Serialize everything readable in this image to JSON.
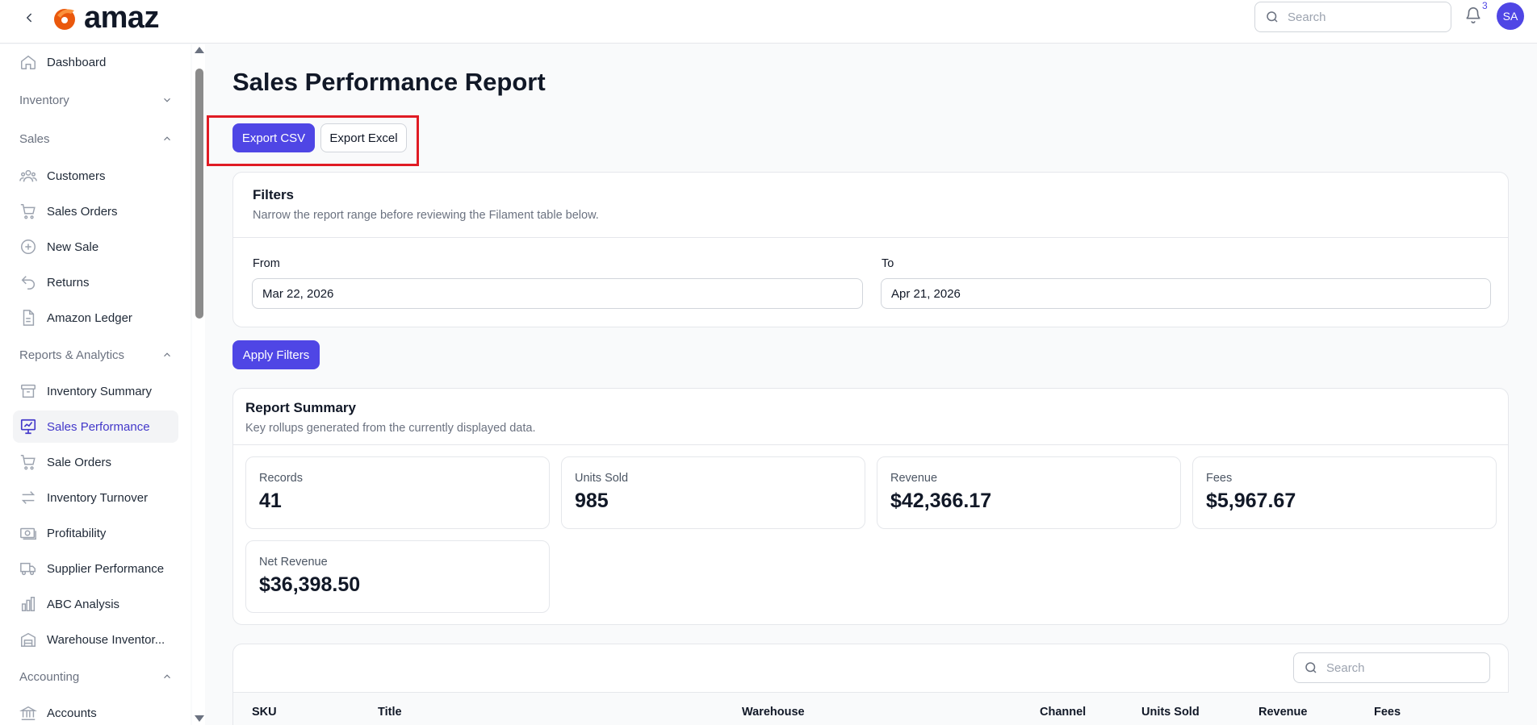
{
  "header": {
    "logo_text": "amaz",
    "search_placeholder": "Search",
    "notification_count": "3",
    "avatar_initials": "SA"
  },
  "sidebar": {
    "dashboard": "Dashboard",
    "inventory_group": "Inventory",
    "sales_group": "Sales",
    "customers": "Customers",
    "sales_orders": "Sales Orders",
    "new_sale": "New Sale",
    "returns": "Returns",
    "amazon_ledger": "Amazon Ledger",
    "reports_group": "Reports & Analytics",
    "inventory_summary": "Inventory Summary",
    "sales_performance": "Sales Performance",
    "sale_orders": "Sale Orders",
    "inventory_turnover": "Inventory Turnover",
    "profitability": "Profitability",
    "supplier_performance": "Supplier Performance",
    "abc_analysis": "ABC Analysis",
    "warehouse_inventory": "Warehouse Inventor...",
    "accounting_group": "Accounting",
    "accounts": "Accounts"
  },
  "main": {
    "title": "Sales Performance Report",
    "export_csv": "Export CSV",
    "export_excel": "Export Excel",
    "filters": {
      "title": "Filters",
      "subtitle": "Narrow the report range before reviewing the Filament table below.",
      "from_label": "From",
      "from_value": "Mar 22, 2026",
      "to_label": "To",
      "to_value": "Apr 21, 2026"
    },
    "apply_filters": "Apply Filters",
    "summary": {
      "title": "Report Summary",
      "subtitle": "Key rollups generated from the currently displayed data.",
      "stats": [
        {
          "label": "Records",
          "value": "41"
        },
        {
          "label": "Units Sold",
          "value": "985"
        },
        {
          "label": "Revenue",
          "value": "$42,366.17"
        },
        {
          "label": "Fees",
          "value": "$5,967.67"
        },
        {
          "label": "Net Revenue",
          "value": "$36,398.50"
        }
      ]
    },
    "table": {
      "search_placeholder": "Search",
      "columns": [
        "SKU",
        "Title",
        "Warehouse",
        "Channel",
        "Units Sold",
        "Revenue",
        "Fees"
      ]
    }
  },
  "colors": {
    "accent": "#4f46e5",
    "highlight": "#e01b24"
  }
}
